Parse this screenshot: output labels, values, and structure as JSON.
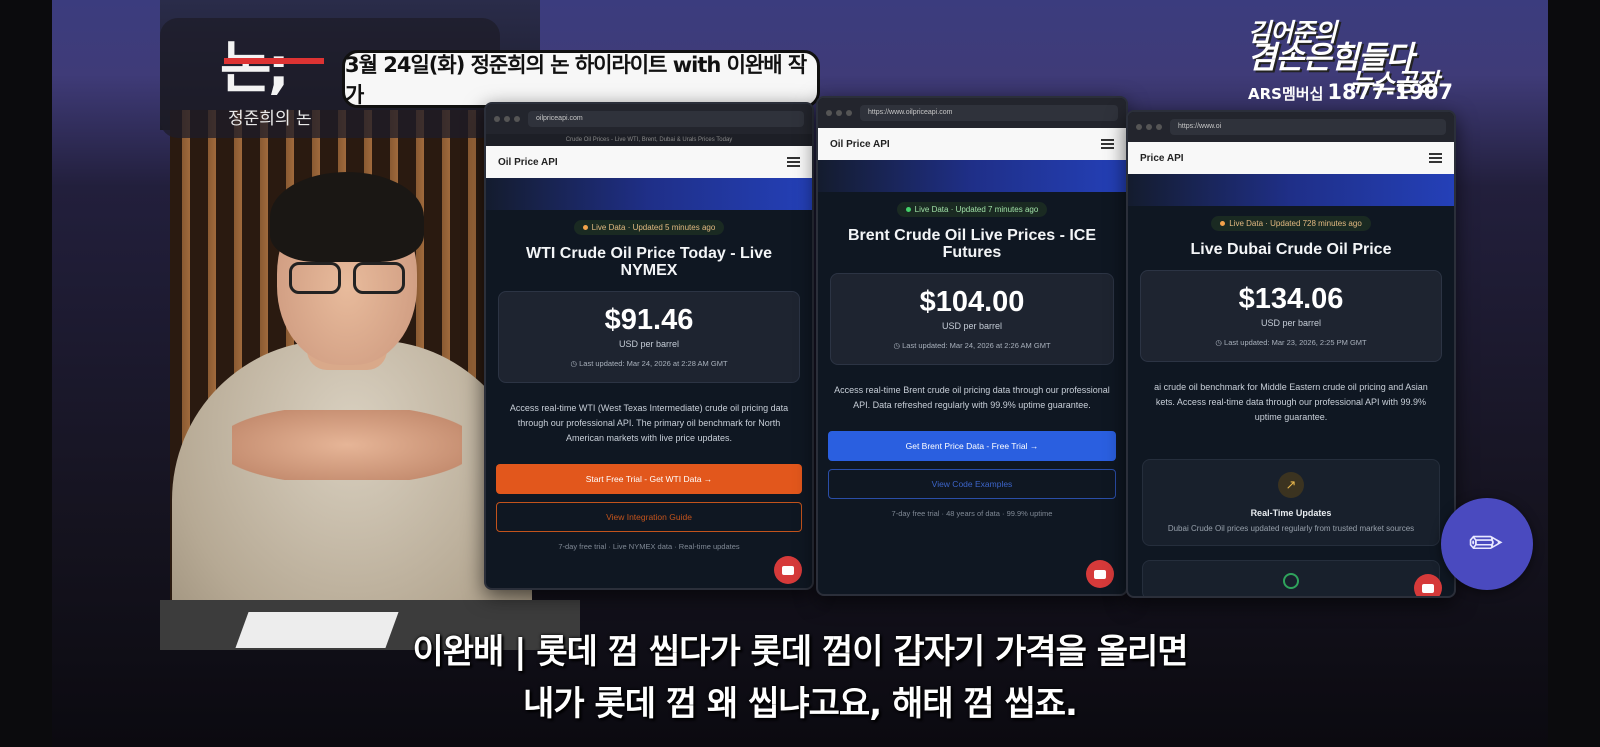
{
  "overlay": {
    "logo_sub": "정준희의 논",
    "headline": "3월 24일(화) 정준희의 논 하이라이트 with 이완배 작가",
    "show_title_l1": "김어준의",
    "show_title_l2": "겸손은힘들다",
    "show_title_l3": "뉴스공장",
    "ars_label": "ARS멤버십",
    "ars_number": "1877-1907"
  },
  "windows": [
    {
      "url": "oilpriceapi.com",
      "tab": "Crude Oil Prices - Live WTI, Brent, Dubai & Urals Prices Today",
      "brand": "Oil Price API",
      "live": "Live Data · Updated 5 minutes ago",
      "title": "WTI Crude Oil Price Today - Live NYMEX",
      "price": "$91.46",
      "unit": "USD per barrel",
      "updated": "Last updated: Mar 24, 2026 at 2:28 AM GMT",
      "desc": "Access real-time WTI (West Texas Intermediate) crude oil pricing data through our professional API. The primary oil benchmark for North American markets with live price updates.",
      "cta": "Start Free Trial - Get WTI Data →",
      "secondary": "View Integration Guide",
      "note": "7-day free trial · Live NYMEX data · Real-time updates"
    },
    {
      "url": "https://www.oilpriceapi.com",
      "brand": "Oil Price API",
      "live": "Live Data · Updated 7 minutes ago",
      "title": "Brent Crude Oil Live Prices - ICE Futures",
      "price": "$104.00",
      "unit": "USD per barrel",
      "updated": "Last updated: Mar 24, 2026 at 2:26 AM GMT",
      "desc": "Access real-time Brent crude oil pricing data through our professional API. Data refreshed regularly with 99.9% uptime guarantee.",
      "cta": "Get Brent Price Data - Free Trial →",
      "secondary": "View Code Examples",
      "note": "7-day free trial · 48 years of data · 99.9% uptime"
    },
    {
      "url": "https://www.oi",
      "brand": "Price API",
      "live": "Live Data · Updated 728 minutes ago",
      "title": "Live Dubai Crude Oil Price",
      "price": "$134.06",
      "unit": "USD per barrel",
      "updated": "Last updated: Mar 23, 2026, 2:25 PM GMT",
      "desc": "ai crude oil benchmark for Middle Eastern crude oil pricing and Asian kets. Access real-time data through our professional API with 99.9% uptime guarantee.",
      "feature_title": "Real-Time Updates",
      "feature_desc": "Dubai Crude Oil prices updated regularly from trusted market sources"
    }
  ],
  "subtitles": {
    "line1": "이완배 | 롯데 껌 씹다가 롯데 껌이 갑자기 가격을 올리면",
    "line2": "내가 롯데 껌 왜 씹냐고요, 해태 껌 씹죠."
  },
  "icons": {
    "fab": "pencil-icon",
    "clock": "clock-icon",
    "chat": "chat-icon",
    "trend": "trend-up-icon",
    "check": "check-circle-icon",
    "menu": "menu-icon"
  },
  "colors": {
    "cta_orange": "#e2571c",
    "cta_blue": "#2a5fe0",
    "fab": "#4a4abf",
    "chat_button": "#d63a3a"
  }
}
